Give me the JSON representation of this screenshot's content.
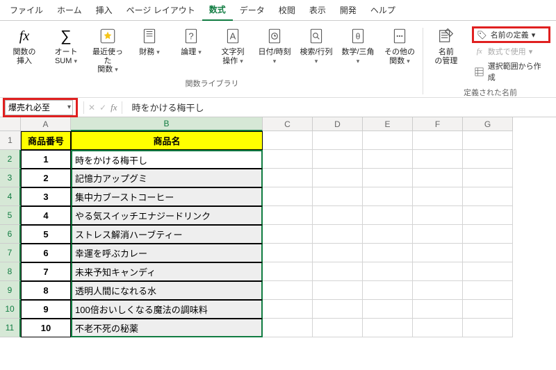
{
  "tabs": {
    "file": "ファイル",
    "home": "ホーム",
    "insert": "挿入",
    "pagelayout": "ページ レイアウト",
    "formulas": "数式",
    "data": "データ",
    "review": "校閲",
    "view": "表示",
    "developer": "開発",
    "help": "ヘルプ"
  },
  "ribbon": {
    "insertfn": "関数の\n挿入",
    "autosum": "オート\nSUM",
    "recent": "最近使った\n関数",
    "financial": "財務",
    "logical": "論理",
    "text": "文字列\n操作",
    "datetime": "日付/時刻",
    "lookup": "検索/行列",
    "math": "数学/三角",
    "more": "その他の\n関数",
    "namemgr": "名前\nの管理",
    "definename": "名前の定義",
    "useinformula": "数式で使用",
    "createfromsel": "選択範囲から作成",
    "grouplib": "関数ライブラリ",
    "groupnames": "定義された名前"
  },
  "formula_bar": {
    "namebox": "爆売れ必至",
    "content": "時をかける梅干し"
  },
  "columns": [
    "A",
    "B",
    "C",
    "D",
    "E",
    "F",
    "G"
  ],
  "header_row": {
    "colA": "商品番号",
    "colB": "商品名"
  },
  "data_rows": [
    {
      "n": "1",
      "name": "時をかける梅干し"
    },
    {
      "n": "2",
      "name": "記憶力アップグミ"
    },
    {
      "n": "3",
      "name": "集中力ブーストコーヒー"
    },
    {
      "n": "4",
      "name": "やる気スイッチエナジードリンク"
    },
    {
      "n": "5",
      "name": "ストレス解消ハーブティー"
    },
    {
      "n": "6",
      "name": "幸運を呼ぶカレー"
    },
    {
      "n": "7",
      "name": "未来予知キャンディ"
    },
    {
      "n": "8",
      "name": "透明人間になれる水"
    },
    {
      "n": "9",
      "name": "100倍おいしくなる魔法の調味料"
    },
    {
      "n": "10",
      "name": "不老不死の秘薬"
    }
  ]
}
